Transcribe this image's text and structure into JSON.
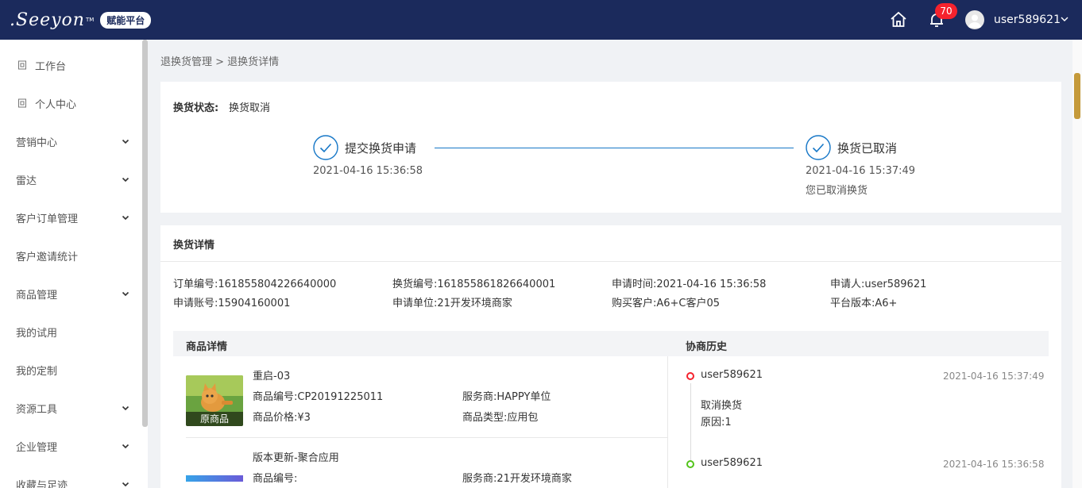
{
  "header": {
    "logo_text": ".Seeyon",
    "logo_tm": "TM",
    "platform_badge": "赋能平台",
    "notification_count": "70",
    "username": "user589621"
  },
  "sidebar": {
    "items": [
      {
        "label": "工作台",
        "has_icon": true,
        "has_chevron": false
      },
      {
        "label": "个人中心",
        "has_icon": true,
        "has_chevron": false
      },
      {
        "label": "营销中心",
        "has_icon": false,
        "has_chevron": true
      },
      {
        "label": "雷达",
        "has_icon": false,
        "has_chevron": true
      },
      {
        "label": "客户订单管理",
        "has_icon": false,
        "has_chevron": true
      },
      {
        "label": "客户邀请统计",
        "has_icon": false,
        "has_chevron": false
      },
      {
        "label": "商品管理",
        "has_icon": false,
        "has_chevron": true
      },
      {
        "label": "我的试用",
        "has_icon": false,
        "has_chevron": false
      },
      {
        "label": "我的定制",
        "has_icon": false,
        "has_chevron": false
      },
      {
        "label": "资源工具",
        "has_icon": false,
        "has_chevron": true
      },
      {
        "label": "企业管理",
        "has_icon": false,
        "has_chevron": true
      },
      {
        "label": "收藏与足迹",
        "has_icon": false,
        "has_chevron": true
      }
    ]
  },
  "breadcrumb": "退换货管理 > 退换货详情",
  "status": {
    "label": "换货状态:",
    "value": "换货取消",
    "steps": [
      {
        "title": "提交换货申请",
        "time": "2021-04-16 15:36:58",
        "note": ""
      },
      {
        "title": "换货已取消",
        "time": "2021-04-16 15:37:49",
        "note": "您已取消换货"
      }
    ]
  },
  "detail": {
    "title": "换货详情",
    "row1": {
      "order_no": "订单编号:161855804226640000",
      "exchange_no": "换货编号:161855861826640001",
      "apply_time": "申请时间:2021-04-16 15:36:58",
      "applicant": "申请人:user589621"
    },
    "row2": {
      "account": "申请账号:15904160001",
      "unit": "申请单位:21开发环境商家",
      "customer": "购买客户:A6+C客户05",
      "platform_version": "平台版本:A6+"
    },
    "products_header": "商品详情",
    "history_header": "协商历史",
    "products": [
      {
        "name": "重启-03",
        "code": "商品编号:CP20191225011",
        "provider": "服务商:HAPPY单位",
        "price": "商品价格:¥3",
        "type": "商品类型:应用包",
        "image_caption": "原商品"
      },
      {
        "name": "版本更新-聚合应用",
        "code": "商品编号:",
        "provider": "服务商:21开发环境商家"
      }
    ],
    "history": [
      {
        "user": "user589621",
        "time": "2021-04-16 15:37:49",
        "action": "取消换货",
        "reason": "原因:1",
        "dot_color": "#f5222d"
      },
      {
        "user": "user589621",
        "time": "2021-04-16 15:36:58",
        "dot_color": "#52c41a"
      }
    ]
  }
}
